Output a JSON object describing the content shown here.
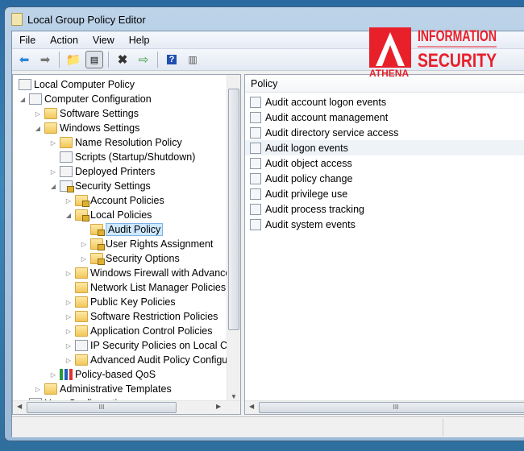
{
  "window": {
    "title": "Local Group Policy Editor"
  },
  "menu": [
    "File",
    "Action",
    "View",
    "Help"
  ],
  "toolbar": [
    {
      "icon": "back-arrow-icon"
    },
    {
      "icon": "forward-arrow-icon"
    },
    {
      "icon": "up-folder-icon"
    },
    {
      "icon": "show-hide-console-tree-icon"
    },
    {
      "icon": "delete-icon"
    },
    {
      "icon": "export-list-icon"
    },
    {
      "icon": "help-icon"
    },
    {
      "icon": "show-hide-action-pane-icon"
    }
  ],
  "tree": [
    {
      "label": "Local Computer Policy",
      "level": 0,
      "icon": "policy",
      "exp": ""
    },
    {
      "label": "Computer Configuration",
      "level": 1,
      "icon": "computer",
      "exp": "open"
    },
    {
      "label": "Software Settings",
      "level": 2,
      "icon": "folder",
      "exp": "closed"
    },
    {
      "label": "Windows Settings",
      "level": 2,
      "icon": "folder",
      "exp": "open"
    },
    {
      "label": "Name Resolution Policy",
      "level": 3,
      "icon": "folder",
      "exp": "closed"
    },
    {
      "label": "Scripts (Startup/Shutdown)",
      "level": 3,
      "icon": "doc",
      "exp": ""
    },
    {
      "label": "Deployed Printers",
      "level": 3,
      "icon": "printer",
      "exp": "closed"
    },
    {
      "label": "Security Settings",
      "level": 3,
      "icon": "security",
      "exp": "open"
    },
    {
      "label": "Account Policies",
      "level": 4,
      "icon": "lockfolder",
      "exp": "closed"
    },
    {
      "label": "Local Policies",
      "level": 4,
      "icon": "lockfolder",
      "exp": "open"
    },
    {
      "label": "Audit Policy",
      "level": 5,
      "icon": "lockfolder",
      "exp": "",
      "selected": true
    },
    {
      "label": "User Rights Assignment",
      "level": 5,
      "icon": "lockfolder",
      "exp": "closed"
    },
    {
      "label": "Security Options",
      "level": 5,
      "icon": "lockfolder",
      "exp": "closed"
    },
    {
      "label": "Windows Firewall with Advance",
      "level": 4,
      "icon": "folder",
      "exp": "closed"
    },
    {
      "label": "Network List Manager Policies",
      "level": 4,
      "icon": "folder",
      "exp": ""
    },
    {
      "label": "Public Key Policies",
      "level": 4,
      "icon": "folder",
      "exp": "closed"
    },
    {
      "label": "Software Restriction Policies",
      "level": 4,
      "icon": "folder",
      "exp": "closed"
    },
    {
      "label": "Application Control Policies",
      "level": 4,
      "icon": "folder",
      "exp": "closed"
    },
    {
      "label": "IP Security Policies on Local Co",
      "level": 4,
      "icon": "ipsec",
      "exp": "closed"
    },
    {
      "label": "Advanced Audit Policy Configu",
      "level": 4,
      "icon": "folder",
      "exp": "closed"
    },
    {
      "label": "Policy-based QoS",
      "level": 3,
      "icon": "chart",
      "exp": "closed"
    },
    {
      "label": "Administrative Templates",
      "level": 2,
      "icon": "folder",
      "exp": "closed"
    },
    {
      "label": "User Configuration",
      "level": 1,
      "icon": "user",
      "exp": ""
    }
  ],
  "list": {
    "header": "Policy",
    "items": [
      "Audit account logon events",
      "Audit account management",
      "Audit directory service access",
      "Audit logon events",
      "Audit object access",
      "Audit policy change",
      "Audit privilege use",
      "Audit process tracking",
      "Audit system events"
    ],
    "hovered": 3
  },
  "watermark": {
    "brand": "ATHENA",
    "line1": "INFORMATION",
    "line2": "SECURITY",
    "color": "#e8202a"
  }
}
